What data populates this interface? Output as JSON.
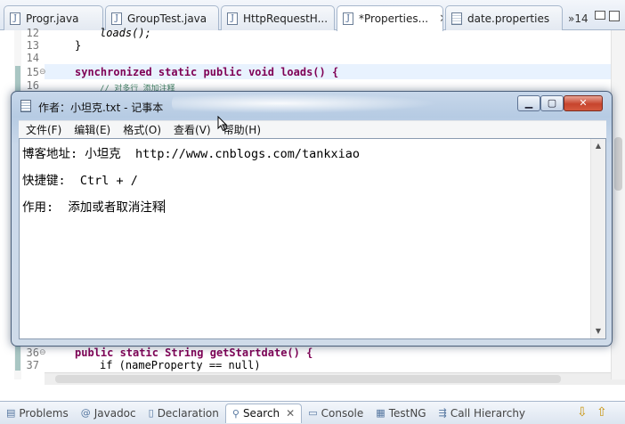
{
  "editor_tabs": [
    {
      "label": "Progr.java",
      "icon": "java-file-icon"
    },
    {
      "label": "GroupTest.java",
      "icon": "java-file-icon"
    },
    {
      "label": "HttpRequestH...",
      "icon": "java-file-icon"
    },
    {
      "label": "*Properties...",
      "icon": "java-file-icon",
      "active": true
    },
    {
      "label": "date.properties",
      "icon": "properties-file-icon"
    }
  ],
  "tab_overflow_count": "»14",
  "code_lines": [
    {
      "num": "12",
      "text": "loads();"
    },
    {
      "num": "13",
      "text": "}"
    },
    {
      "num": "14",
      "text": ""
    },
    {
      "num": "15",
      "text": "synchronized static public void loads() {"
    },
    {
      "num": "16",
      "text": "// 对多行 添加注释"
    },
    {
      "num": "36",
      "text": "public static String getStartdate() {"
    },
    {
      "num": "37",
      "text": "if (nameProperty == null)"
    }
  ],
  "notepad": {
    "title": "作者：小坦克.txt - 记事本",
    "menus": [
      "文件(F)",
      "编辑(E)",
      "格式(O)",
      "查看(V)",
      "帮助(H)"
    ],
    "lines": [
      "博客地址: 小坦克  http://www.cnblogs.com/tankxiao",
      "快捷键:  Ctrl + /",
      "作用:  添加或者取消注释"
    ]
  },
  "bottom_tabs": [
    {
      "label": "Problems",
      "icon": "problems-icon"
    },
    {
      "label": "Javadoc",
      "icon": "javadoc-icon"
    },
    {
      "label": "Declaration",
      "icon": "declaration-icon"
    },
    {
      "label": "Search",
      "icon": "search-icon",
      "active": true
    },
    {
      "label": "Console",
      "icon": "console-icon"
    },
    {
      "label": "TestNG",
      "icon": "testng-icon"
    },
    {
      "label": "Call Hierarchy",
      "icon": "call-hierarchy-icon"
    }
  ],
  "colors": {
    "keyword": "#7f0055",
    "field": "#0000c0",
    "comment": "#3f7f5f",
    "close_button": "#c7442d"
  }
}
